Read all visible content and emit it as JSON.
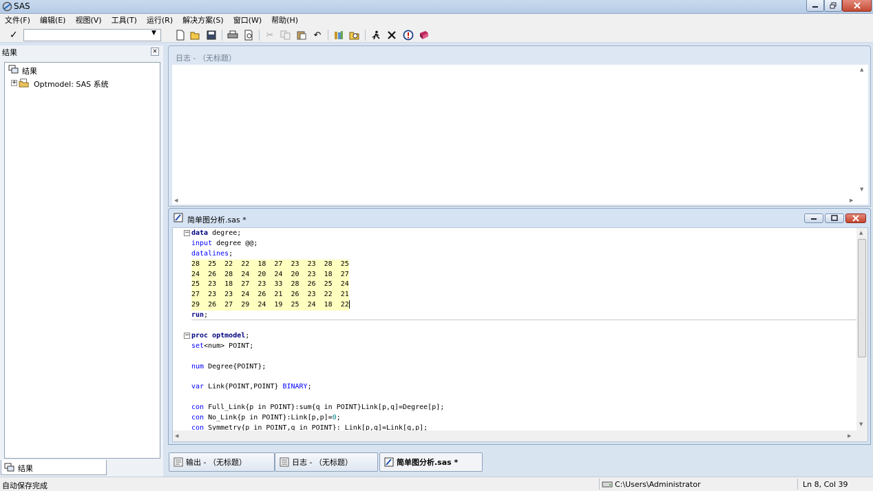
{
  "app": {
    "title": "SAS"
  },
  "menu": [
    "文件(F)",
    "编辑(E)",
    "视图(V)",
    "工具(T)",
    "运行(R)",
    "解决方案(S)",
    "窗口(W)",
    "帮助(H)"
  ],
  "toolbar": {
    "command_value": "",
    "buttons": [
      "new-icon",
      "open-icon",
      "save-icon",
      "print-icon",
      "print-preview-icon",
      "cut-icon",
      "copy-icon",
      "paste-icon",
      "undo-icon",
      "new-library-icon",
      "explorer-icon",
      "submit-icon",
      "clear-icon",
      "break-icon",
      "help-icon"
    ]
  },
  "results": {
    "header": "结果",
    "root_label": "结果",
    "child_label": "Optmodel:  SAS 系统",
    "bottom_tab": "结果"
  },
  "log": {
    "title": "日志 - （无标题）"
  },
  "editor": {
    "title": "简单图分析.sas *",
    "lines": [
      {
        "parts": [
          {
            "t": "data",
            "c": "kw"
          },
          {
            "t": " degree;",
            "c": "tx"
          }
        ],
        "fold": true
      },
      {
        "parts": [
          {
            "t": "input",
            "c": "stmt"
          },
          {
            "t": " degree @@;",
            "c": "tx"
          }
        ]
      },
      {
        "parts": [
          {
            "t": "datalines",
            "c": "stmt"
          },
          {
            "t": ";",
            "c": "tx"
          }
        ]
      },
      {
        "parts": [
          {
            "t": "28  25  22  22  18  27  23  23  28  25",
            "c": "dl"
          }
        ]
      },
      {
        "parts": [
          {
            "t": "24  26  28  24  20  24  20  23  18  27",
            "c": "dl"
          }
        ]
      },
      {
        "parts": [
          {
            "t": "25  23  18  27  23  33  28  26  25  24",
            "c": "dl"
          }
        ]
      },
      {
        "parts": [
          {
            "t": "27  23  23  24  26  21  26  23  22  21",
            "c": "dl"
          }
        ]
      },
      {
        "parts": [
          {
            "t": "29  26  27  29  24  19  25  24  18  22",
            "c": "dl"
          }
        ]
      },
      {
        "parts": [
          {
            "t": "run",
            "c": "kw"
          },
          {
            "t": ";",
            "c": "tx"
          }
        ]
      },
      {
        "parts": [
          {
            "t": "",
            "c": "tx"
          }
        ]
      },
      {
        "parts": [
          {
            "t": "proc optmodel",
            "c": "kw"
          },
          {
            "t": ";",
            "c": "tx"
          }
        ],
        "fold": true
      },
      {
        "parts": [
          {
            "t": "set",
            "c": "stmt"
          },
          {
            "t": "<num> POINT;",
            "c": "tx"
          }
        ]
      },
      {
        "parts": [
          {
            "t": "",
            "c": "tx"
          }
        ]
      },
      {
        "parts": [
          {
            "t": "num",
            "c": "stmt"
          },
          {
            "t": " Degree{POINT};",
            "c": "tx"
          }
        ]
      },
      {
        "parts": [
          {
            "t": "",
            "c": "tx"
          }
        ]
      },
      {
        "parts": [
          {
            "t": "var",
            "c": "stmt"
          },
          {
            "t": " Link{POINT,POINT} ",
            "c": "tx"
          },
          {
            "t": "BINARY",
            "c": "stmt"
          },
          {
            "t": ";",
            "c": "tx"
          }
        ]
      },
      {
        "parts": [
          {
            "t": "",
            "c": "tx"
          }
        ]
      },
      {
        "parts": [
          {
            "t": "con",
            "c": "stmt"
          },
          {
            "t": " Full_Link{p in POINT}:sum{q in POINT}Link[p,q]=Degree[p];",
            "c": "tx"
          }
        ]
      },
      {
        "parts": [
          {
            "t": "con",
            "c": "stmt"
          },
          {
            "t": " No_Link{p in POINT}:Link[p,p]=",
            "c": "tx"
          },
          {
            "t": "0",
            "c": "num"
          },
          {
            "t": ";",
            "c": "tx"
          }
        ]
      },
      {
        "parts": [
          {
            "t": "con",
            "c": "stmt"
          },
          {
            "t": " Symmetry{p in POINT,q in POINT}: Link[p,q]=Link[q,p];",
            "c": "tx"
          }
        ]
      }
    ]
  },
  "tabs": [
    {
      "label": "输出 - （无标题）",
      "icon": "output-window-icon",
      "active": false
    },
    {
      "label": "日志 - （无标题）",
      "icon": "log-window-icon",
      "active": false
    },
    {
      "label": "简单图分析.sas *",
      "icon": "editor-window-icon",
      "active": true
    }
  ],
  "status": {
    "message": "自动保存完成",
    "path": "C:\\Users\\Administrator",
    "position": "Ln 8, Col 39"
  }
}
